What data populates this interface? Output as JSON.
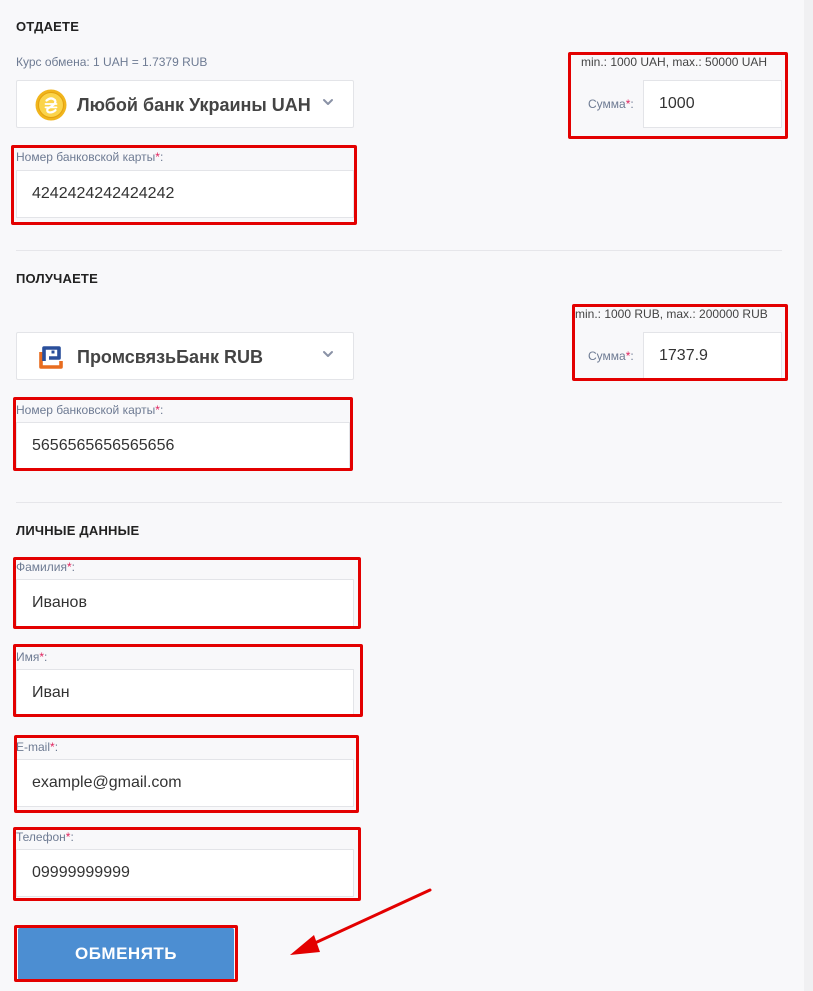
{
  "give": {
    "title": "ОТДАЕТЕ",
    "rate": "Курс обмена: 1 UAH = 1.7379 RUB",
    "bank_name": "Любой банк Украины UAH",
    "limits": "min.: 1000 UAH, max.: 50000 UAH",
    "sum_label": "Сумма",
    "sum_value": "1000",
    "card_label": "Номер банковской карты",
    "card_value": "4242424242424242"
  },
  "receive": {
    "title": "ПОЛУЧАЕТЕ",
    "bank_name": "ПромсвязьБанк RUB",
    "limits": "min.: 1000 RUB, max.: 200000 RUB",
    "sum_label": "Сумма",
    "sum_value": "1737.9",
    "card_label": "Номер банковской карты",
    "card_value": "5656565656565656"
  },
  "personal": {
    "title": "ЛИЧНЫЕ ДАННЫЕ",
    "last_name_label": "Фамилия",
    "last_name_value": "Иванов",
    "first_name_label": "Имя",
    "first_name_value": "Иван",
    "email_label": "E-mail",
    "email_value": "example@gmail.com",
    "phone_label": "Телефон",
    "phone_value": "09999999999"
  },
  "required_mark": "*",
  "submit_label": "ОБМЕНЯТЬ",
  "colors": {
    "accent_button": "#4c8ed2",
    "highlight": "#e30000",
    "label": "#6e7b93",
    "required": "#e0245e"
  },
  "icons": {
    "give_bank": "hryvnia-coin-icon",
    "receive_bank": "psb-logo-icon",
    "dropdown": "chevron-down-icon",
    "annotation": "red-arrow-icon"
  }
}
